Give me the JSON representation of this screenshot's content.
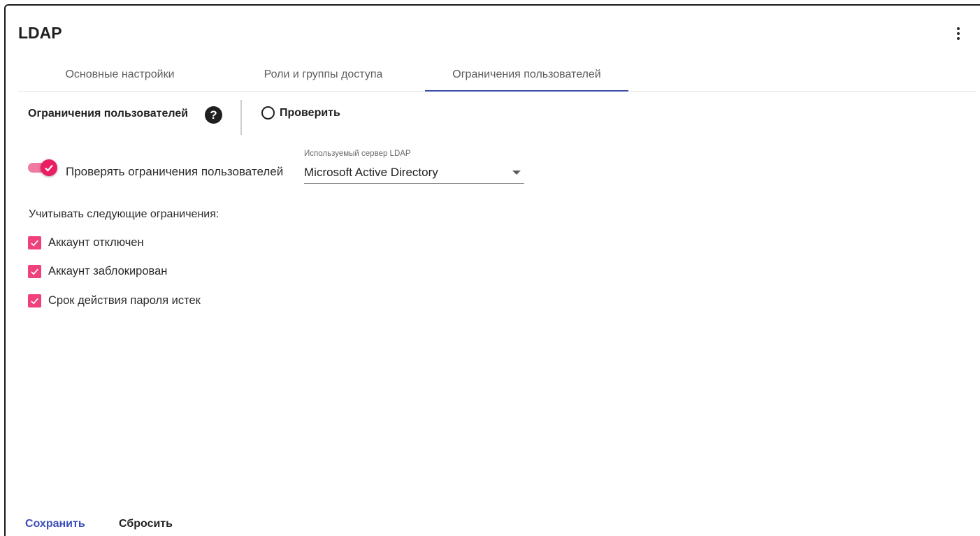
{
  "header": {
    "title": "LDAP",
    "menu_icon": "more-vert-icon"
  },
  "tabs": [
    {
      "label": "Основные настройки",
      "active": false
    },
    {
      "label": "Роли и группы доступа",
      "active": false
    },
    {
      "label": "Ограничения пользователей",
      "active": true
    }
  ],
  "section": {
    "title": "Ограничения пользователей",
    "help_icon": "help-circle-icon",
    "check_label": "Проверить"
  },
  "toggle": {
    "label": "Проверять ограничения пользователей",
    "checked": true
  },
  "server": {
    "caption": "Используемый сервер LDAP",
    "value": "Microsoft Active Directory"
  },
  "constraints": {
    "title": "Учитывать следующие ограничения:",
    "items": [
      {
        "label": "Аккаунт отключен",
        "checked": true
      },
      {
        "label": "Аккаунт заблокирован",
        "checked": true
      },
      {
        "label": "Срок действия пароля истек",
        "checked": true
      }
    ]
  },
  "footer": {
    "save_label": "Сохранить",
    "reset_label": "Сбросить"
  },
  "colors": {
    "accent": "#e91e63",
    "primary": "#3f4fa8"
  }
}
